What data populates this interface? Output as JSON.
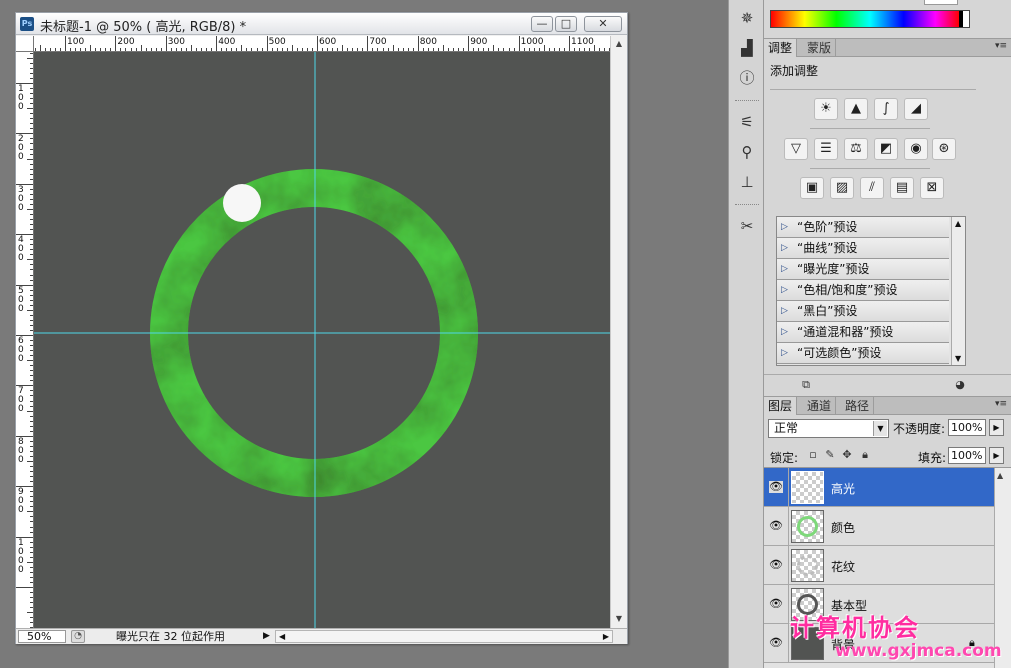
{
  "document": {
    "app_badge": "Ps",
    "title": "未标题-1 @ 50% ( 高光, RGB/8) *",
    "window_buttons": {
      "minimize": "—",
      "maximize": "□",
      "close": "✕"
    },
    "ruler_top_labels": [
      "100",
      "200",
      "300",
      "400",
      "500",
      "600",
      "700",
      "800",
      "900",
      "1000",
      "1100"
    ],
    "ruler_left_labels": [
      "100",
      "200",
      "300",
      "400",
      "500",
      "600",
      "700",
      "800",
      "900",
      "1000"
    ],
    "guides": {
      "color": "#4fd8e8"
    },
    "ring_color": "#4cc742",
    "status": {
      "zoom": "50%",
      "message": "曝光只在 32 位起作用",
      "arrow": "▶"
    }
  },
  "dock": {
    "icons": [
      "navigator-wheel-icon",
      "histogram-icon",
      "info-icon",
      "brush-preset-icon",
      "clone-source-icon",
      "stamp-icon",
      "tools-icon"
    ]
  },
  "adjustments_panel": {
    "tabs": [
      {
        "label": "调整",
        "active": true
      },
      {
        "label": "蒙版",
        "active": false
      }
    ],
    "menu_glyph": "▾≡",
    "heading": "添加调整",
    "presets": [
      "“色阶”预设",
      "“曲线”预设",
      "“曝光度”预设",
      "“色相/饱和度”预设",
      "“黑白”预设",
      "“通道混和器”预设",
      "“可选颜色”预设"
    ]
  },
  "layers_panel": {
    "tabs": [
      {
        "label": "图层",
        "active": true
      },
      {
        "label": "通道",
        "active": false
      },
      {
        "label": "路径",
        "active": false
      }
    ],
    "blend_mode": "正常",
    "opacity_label": "不透明度:",
    "opacity_value": "100%",
    "lock_label": "锁定:",
    "fill_label": "填充:",
    "fill_value": "100%",
    "layers": [
      {
        "name": "高光",
        "selected": true
      },
      {
        "name": "颜色",
        "selected": false
      },
      {
        "name": "花纹",
        "selected": false
      },
      {
        "name": "基本型",
        "selected": false
      },
      {
        "name": "背景",
        "selected": false
      }
    ],
    "selection_color": "#3268c8"
  },
  "watermark": {
    "text": "计算机协会",
    "sub": "www.gxjmca.com"
  }
}
